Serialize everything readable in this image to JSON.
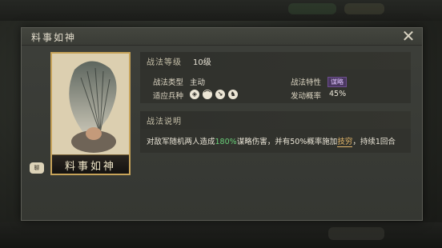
{
  "dialog": {
    "title": "料事如神",
    "close_label": "✕"
  },
  "card": {
    "name": "料事如神",
    "chat_badge": "聊"
  },
  "skill": {
    "level_label": "战法等级",
    "level_value": "10级",
    "type_label": "战法类型",
    "type_value": "主动",
    "trait_label": "战法特性",
    "trait_value": "谋略",
    "units_label": "适应兵种",
    "units": [
      "shield-icon",
      "bow-icon",
      "spear-icon",
      "horse-icon"
    ],
    "rate_label": "发动概率",
    "rate_value": "45%",
    "desc_title": "战法说明",
    "desc_part1": "对敌军随机两人造成",
    "desc_pct": "180%",
    "desc_part2": "谋略伤害，并有50%概率施加",
    "desc_keyword": "技穷",
    "desc_part3": "，持续1回合"
  },
  "colors": {
    "accent_gold": "#c8a45a",
    "tag_purple": "#4a3760",
    "desc_green": "#6ad07a"
  }
}
